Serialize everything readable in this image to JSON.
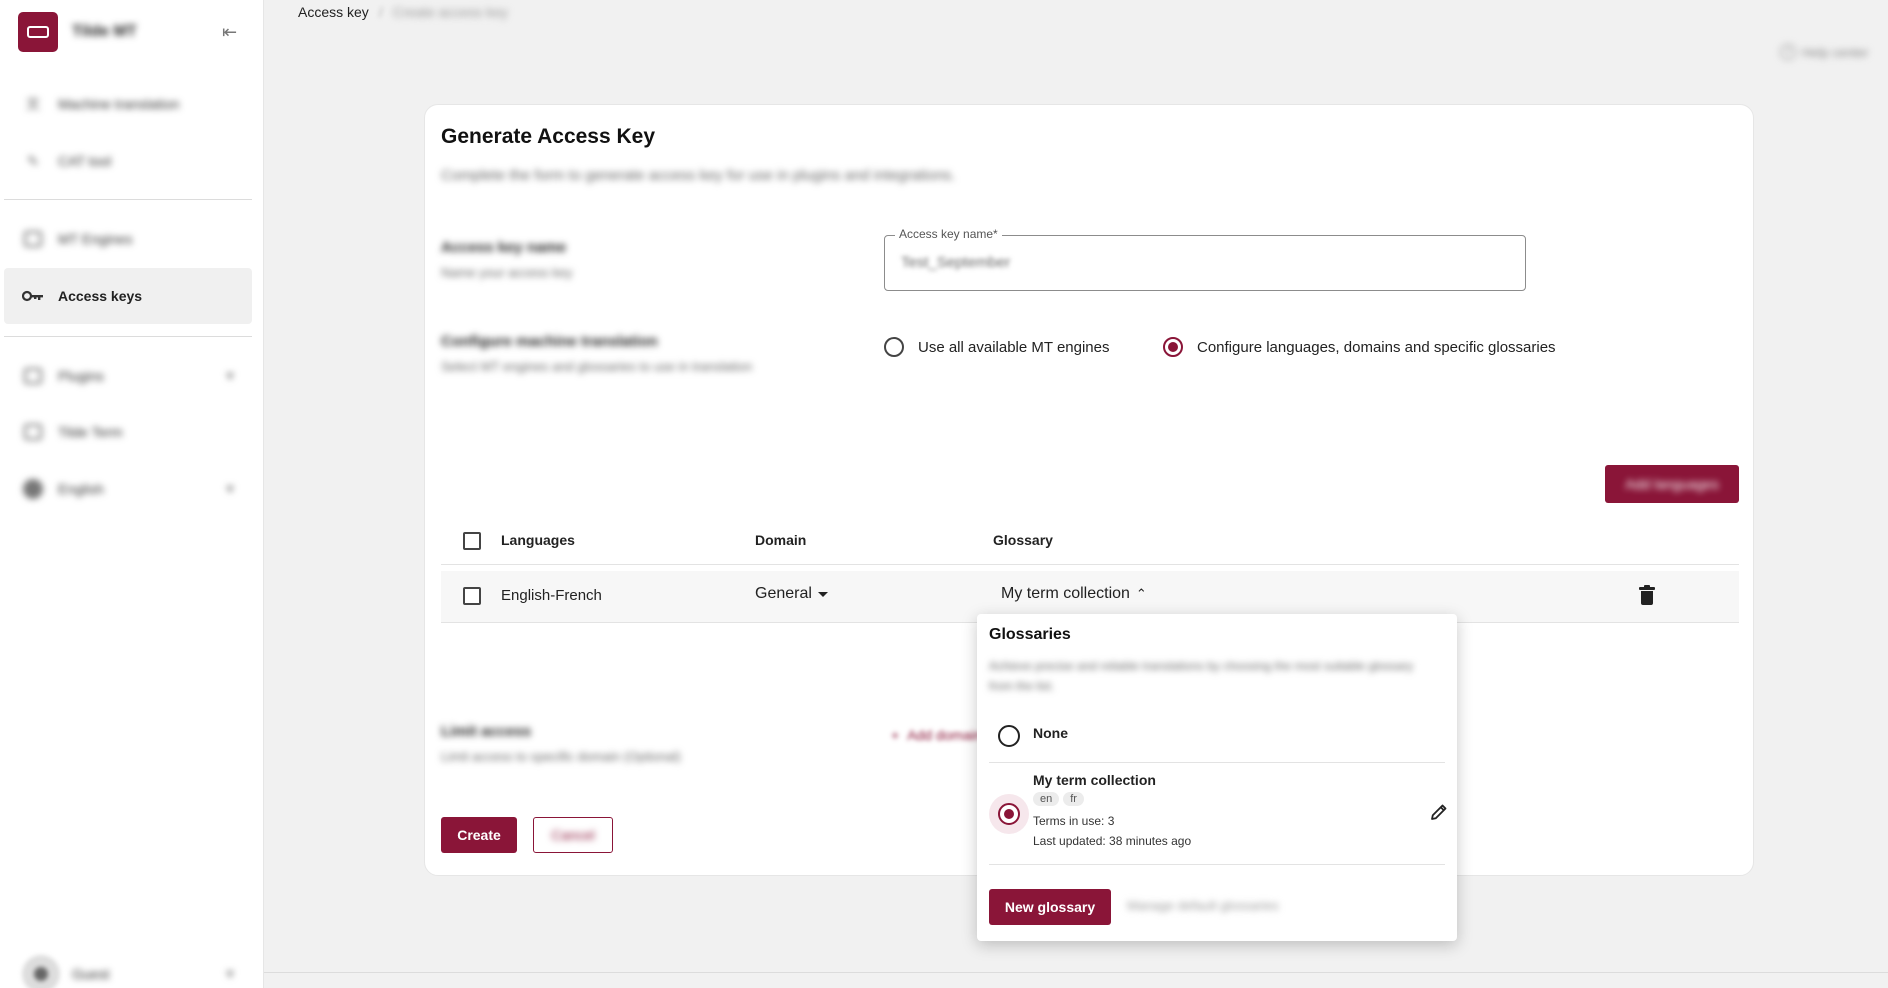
{
  "sidebar": {
    "brand_name": "Tilde MT",
    "items": [
      {
        "label": "Machine translation",
        "icon": "translate-icon"
      },
      {
        "label": "CAT tool",
        "icon": "cat-tool-icon"
      },
      {
        "label": "MT Engines",
        "icon": "engines-icon"
      },
      {
        "label": "Access keys",
        "icon": "key-icon"
      },
      {
        "label": "Plugins",
        "icon": "plugins-icon"
      },
      {
        "label": "Tilde Term",
        "icon": "term-icon"
      },
      {
        "label": "English",
        "icon": "globe-icon"
      }
    ],
    "user_label": "Guest"
  },
  "header": {
    "breadcrumb_current": "Access key",
    "breadcrumb_separator": "/",
    "breadcrumb_sub": "Create access key",
    "help_label": "Help center"
  },
  "form": {
    "title": "Generate Access Key",
    "description": "Complete the form to generate access key for use in plugins and integrations.",
    "name_section": {
      "title": "Access key name",
      "subtitle": "Name your access key",
      "field_label": "Access key name*",
      "field_value": "Test_September"
    },
    "mt_section": {
      "title": "Configure machine translation",
      "subtitle": "Select MT engines and glossaries to use in translation",
      "option_all": "Use all available MT engines",
      "option_configure": "Configure languages, domains and specific glossaries",
      "selected": "configure"
    },
    "add_languages_label": "Add languages",
    "table": {
      "headers": {
        "languages": "Languages",
        "domain": "Domain",
        "glossary": "Glossary"
      },
      "rows": [
        {
          "languages": "English-French",
          "domain": "General",
          "glossary": "My term collection"
        }
      ]
    },
    "limit_section": {
      "title": "Limit access",
      "subtitle": "Limit access to specific domain (Optional)",
      "add_domain_label": "Add domain"
    },
    "create_label": "Create",
    "cancel_label": "Cancel"
  },
  "popover": {
    "title": "Glossaries",
    "description": "Achieve precise and reliable translations by choosing the most suitable glossary from the list.",
    "options": [
      {
        "label": "None"
      },
      {
        "label": "My term collection",
        "chips": [
          "en",
          "fr"
        ],
        "terms": "Terms in use: 3",
        "updated": "Last updated: 38 minutes ago"
      }
    ],
    "selected_index": 1,
    "new_glossary_label": "New glossary",
    "manage_label": "Manage default glossaries"
  },
  "colors": {
    "accent": "#8a1538",
    "background": "#f1f1f1"
  }
}
